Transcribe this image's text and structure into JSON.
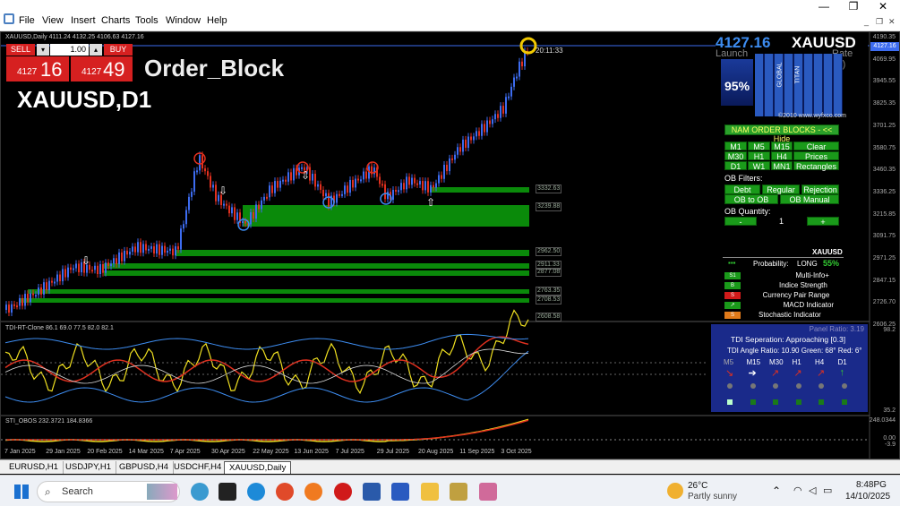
{
  "menu": {
    "items": [
      "File",
      "View",
      "Insert",
      "Charts",
      "Tools",
      "Window",
      "Help"
    ]
  },
  "window_controls": {
    "min": "—",
    "max": "❐",
    "close": "✕"
  },
  "mdi_controls": {
    "min": "_",
    "restore": "❐",
    "close": "✕"
  },
  "chart": {
    "symbol_info": "XAUUSD,Daily  4111.24 4132.25 4106.63 4127.16",
    "title": "Order_Block",
    "symbol_tf": "XAUUSD,D1",
    "timer": "20:11:33",
    "price_axis": [
      "4190.35",
      "4069.95",
      "3945.55",
      "3825.35",
      "3701.25",
      "3580.75",
      "3460.35",
      "3336.25",
      "3215.85",
      "3091.75",
      "2971.25",
      "2847.15",
      "2726.70",
      "2606.25"
    ],
    "current_price": "4127.16",
    "ob_levels": [
      "3332.63",
      "3239.88",
      "2962.50",
      "2911.33",
      "2877.08",
      "2763.35",
      "2708.53",
      "2608.58"
    ],
    "date_axis": [
      "7 Jan 2025",
      "29 Jan 2025",
      "20 Feb 2025",
      "14 Mar 2025",
      "7 Apr 2025",
      "30 Apr 2025",
      "22 May 2025",
      "13 Jun 2025",
      "7 Jul 2025",
      "29 Jul 2025",
      "20 Aug 2025",
      "11 Sep 2025",
      "3 Oct 2025"
    ]
  },
  "trade": {
    "sell": "SELL",
    "buy": "BUY",
    "lot": "1.00",
    "bid_prefix": "4127",
    "bid_big": "16",
    "ask_prefix": "4127",
    "ask_big": "49"
  },
  "wyfx": {
    "price": "4127.16",
    "symbol": "XAUUSD",
    "launch": "Launch",
    "rate": "Rate (R)",
    "pct": "95%",
    "global": "GLOBAL",
    "titan": "TITAN",
    "copyright": "©2010 www.wyfxco.com"
  },
  "ob_panel": {
    "header": "NAM ORDER BLOCKS - << Hide",
    "tf_rows": [
      [
        "M1",
        "M5",
        "M15",
        "Clear"
      ],
      [
        "M30",
        "H1",
        "H4",
        "Prices"
      ],
      [
        "D1",
        "W1",
        "MN1",
        "Rectangles"
      ]
    ],
    "filters_label": "OB Filters:",
    "filters": [
      [
        "Debt",
        "Regular",
        "Rejection"
      ],
      [
        "OB to OB",
        "OB Manual"
      ]
    ],
    "qty_label": "OB Quantity:",
    "qty_minus": "-",
    "qty_value": "1",
    "qty_plus": "+"
  },
  "info_panel": {
    "symbol": "XAUUSD",
    "prob_label": "Probability:",
    "prob_dir": "LONG",
    "prob_val": "55%",
    "rows": [
      {
        "badge": "S1",
        "label": "Multi-Info+"
      },
      {
        "badge": "B",
        "label": "Indice Strength"
      },
      {
        "badge": "S",
        "label": "Currency Pair Range"
      },
      {
        "badge": "↗",
        "label": "MACD Indicator"
      },
      {
        "badge": "S",
        "label": "Stochastic Indicator"
      }
    ]
  },
  "tdi": {
    "label": "TDI-RT-Clone 86.1 69.0 77.5 82.0 82.1",
    "panel_ratio": "Panel Ratio: 3.19",
    "separation": "TDI Seperation: Approaching [0.3]",
    "angle": "TDI Angle Ratio: 10.90  Green: 68°  Red: 6°",
    "tfs": [
      "M5",
      "M15",
      "M30",
      "H1",
      "H4",
      "D1"
    ],
    "ticks": [
      "98.2",
      "35.2"
    ]
  },
  "sti": {
    "label": "STI_OBOS 232.3721 184.8366",
    "ticks": [
      "248.0344",
      "0.00",
      "-3.9"
    ]
  },
  "tabs": [
    "EURUSD,H1",
    "USDJPY,H1",
    "GBPUSD,H4",
    "USDCHF,H4",
    "XAUUSD,Daily"
  ],
  "taskbar": {
    "search": "Search",
    "weather_temp": "26°C",
    "weather_desc": "Partly sunny",
    "time": "8:48PG",
    "date": "14/10/2025"
  },
  "colors": {
    "bull": "#3d6cf0",
    "bear": "#e0301f",
    "ob": "#0a8a0a",
    "panel_green": "#1a9a1a",
    "tdi_bg": "#1a2a8a"
  }
}
